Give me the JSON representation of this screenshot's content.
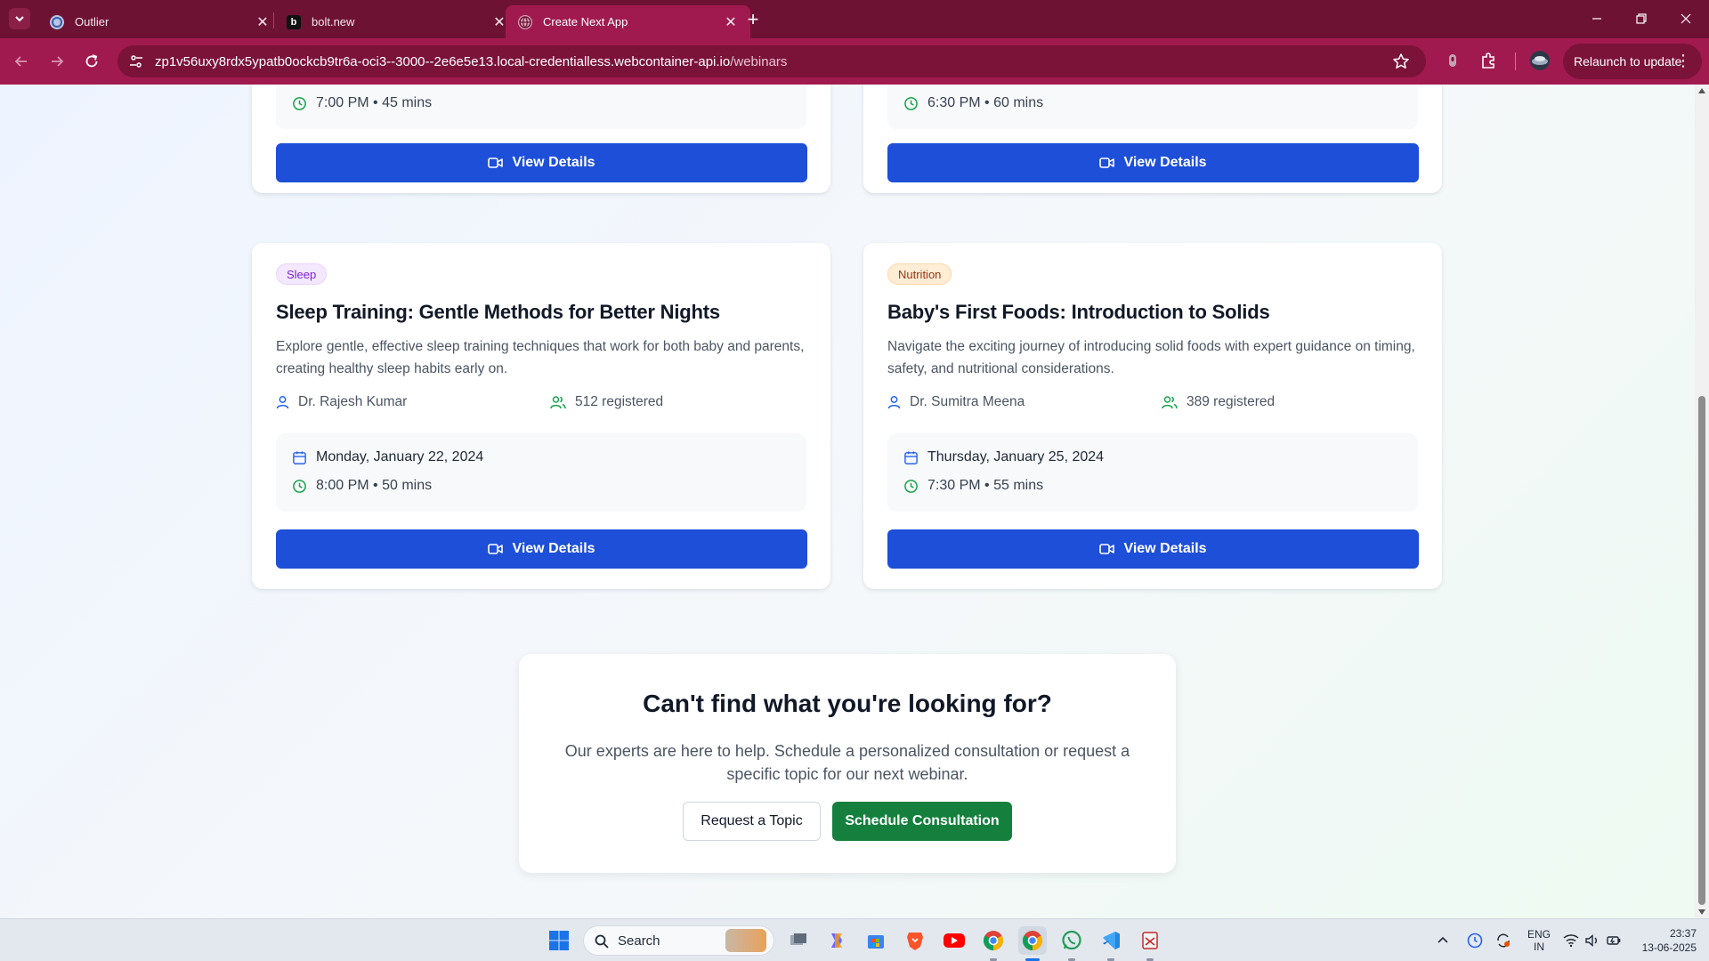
{
  "browser": {
    "tabs": [
      {
        "title": "Outlier",
        "icon": "outlier-icon",
        "active": false
      },
      {
        "title": "bolt.new",
        "icon": "bolt-icon",
        "active": false
      },
      {
        "title": "Create Next App",
        "icon": "globe-icon",
        "active": true
      }
    ],
    "url_host": "zp1v56uxy8rdx5ypatb0ockcb9tr6a-oci3--3000--2e6e5e13.local-credentialless.webcontainer-api.io",
    "url_path": "/webinars",
    "relaunch_label": "Relaunch to update"
  },
  "webinars_top": [
    {
      "time": "7:00 PM • 45 mins",
      "button": "View Details"
    },
    {
      "time": "6:30 PM • 60 mins",
      "button": "View Details"
    }
  ],
  "webinars": [
    {
      "category": "Sleep",
      "title": "Sleep Training: Gentle Methods for Better Nights",
      "description": "Explore gentle, effective sleep training techniques that work for both baby and parents, creating healthy sleep habits early on.",
      "host": "Dr. Rajesh Kumar",
      "registered": "512 registered",
      "date": "Monday, January 22, 2024",
      "time": "8:00 PM • 50 mins",
      "button": "View Details"
    },
    {
      "category": "Nutrition",
      "title": "Baby's First Foods: Introduction to Solids",
      "description": "Navigate the exciting journey of introducing solid foods with expert guidance on timing, safety, and nutritional considerations.",
      "host": "Dr. Sumitra Meena",
      "registered": "389 registered",
      "date": "Thursday, January 25, 2024",
      "time": "7:30 PM • 55 mins",
      "button": "View Details"
    }
  ],
  "cta": {
    "title": "Can't find what you're looking for?",
    "description": "Our experts are here to help. Schedule a personalized consultation or request a specific topic for our next webinar.",
    "request_label": "Request a Topic",
    "schedule_label": "Schedule Consultation"
  },
  "taskbar": {
    "search_label": "Search",
    "lang_top": "ENG",
    "lang_bottom": "IN",
    "time": "23:37",
    "date": "13-06-2025"
  },
  "colors": {
    "chrome": "#a11a4f",
    "primary_button": "#1d4fd8",
    "green_button": "#15803d"
  }
}
